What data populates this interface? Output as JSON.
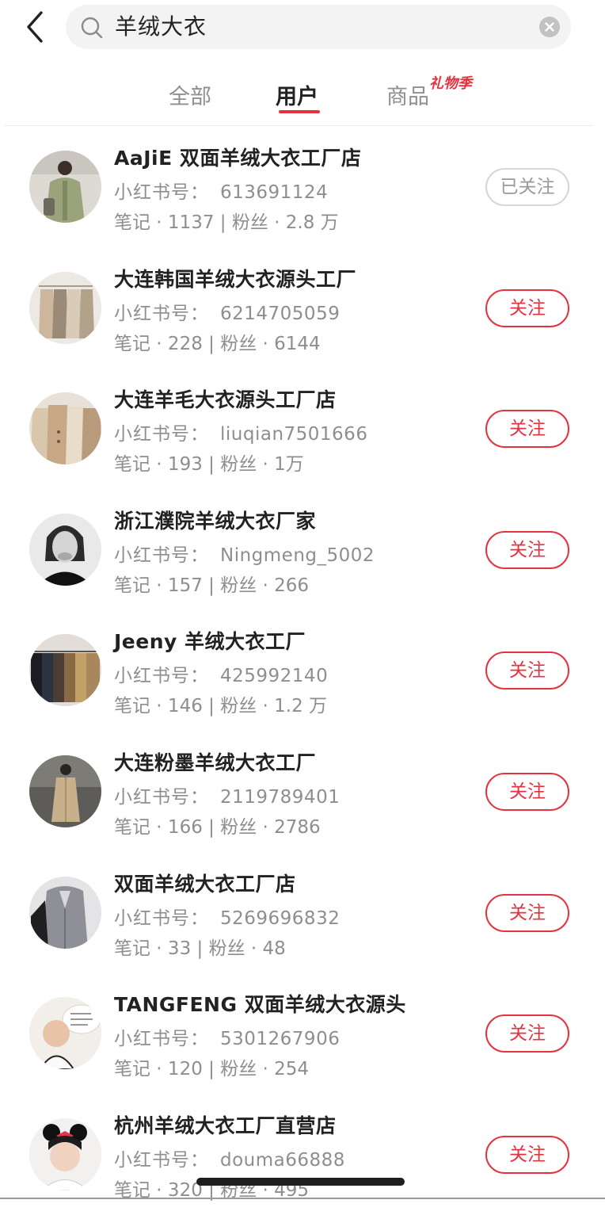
{
  "search": {
    "query": "羊绒大衣"
  },
  "tabs": [
    {
      "label": "全部",
      "active": false
    },
    {
      "label": "用户",
      "active": true
    },
    {
      "label": "商品",
      "active": false,
      "badge": "礼物季"
    }
  ],
  "colors": {
    "accent": "#e5323f",
    "secondary_text": "#8e8e8e",
    "primary_text": "#222222"
  },
  "id_label": "小红书号：",
  "users": [
    {
      "name": "AaJiE 双面羊绒大衣工厂店",
      "id": "613691124",
      "stats": "笔记 · 1137 | 粉丝 · 2.8 万",
      "follow": "已关注",
      "followed": true,
      "avatar": "green-coat-avatar"
    },
    {
      "name": "大连韩国羊绒大衣源头工厂",
      "id": "6214705059",
      "stats": "笔记 · 228 | 粉丝 · 6144",
      "follow": "关注",
      "followed": false,
      "avatar": "coats-rack-avatar"
    },
    {
      "name": "大连羊毛大衣源头工厂店",
      "id": "liuqian7501666",
      "stats": "笔记 · 193 | 粉丝 · 1万",
      "follow": "关注",
      "followed": false,
      "avatar": "beige-coats-avatar"
    },
    {
      "name": "浙江濮院羊绒大衣厂家",
      "id": "Ningmeng_5002",
      "stats": "笔记 · 157 | 粉丝 · 266",
      "follow": "关注",
      "followed": false,
      "avatar": "portrait-avatar"
    },
    {
      "name": "Jeeny 羊绒大衣工厂",
      "id": "425992140",
      "stats": "笔记 · 146 | 粉丝 · 1.2 万",
      "follow": "关注",
      "followed": false,
      "avatar": "clothing-rack-avatar"
    },
    {
      "name": "大连粉墨羊绒大衣工厂",
      "id": "2119789401",
      "stats": "笔记 · 166 | 粉丝 · 2786",
      "follow": "关注",
      "followed": false,
      "avatar": "trench-coat-avatar"
    },
    {
      "name": "双面羊绒大衣工厂店",
      "id": "5269696832",
      "stats": "笔记 · 33 | 粉丝 · 48",
      "follow": "关注",
      "followed": false,
      "avatar": "grey-coat-avatar"
    },
    {
      "name": "TANGFENG 双面羊绒大衣源头",
      "id": "5301267906",
      "stats": "笔记 · 120 | 粉丝 · 254",
      "follow": "关注",
      "followed": false,
      "avatar": "baby-avatar"
    },
    {
      "name": "杭州羊绒大衣工厂直营店",
      "id": "douma66888",
      "stats": "笔记 · 320 | 粉丝 · 495",
      "follow": "关注",
      "followed": false,
      "avatar": "minnie-ears-avatar"
    }
  ]
}
